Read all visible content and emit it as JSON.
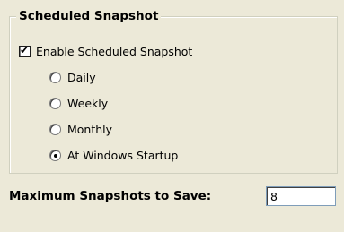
{
  "group": {
    "title": "Scheduled Snapshot",
    "enable": {
      "label": "Enable Scheduled Snapshot",
      "checked": true
    }
  },
  "options": [
    {
      "label": "Daily",
      "selected": false
    },
    {
      "label": "Weekly",
      "selected": false
    },
    {
      "label": "Monthly",
      "selected": false
    },
    {
      "label": "At Windows Startup",
      "selected": true
    }
  ],
  "max_snapshots": {
    "label": "Maximum Snapshots to Save:",
    "value": "8"
  }
}
